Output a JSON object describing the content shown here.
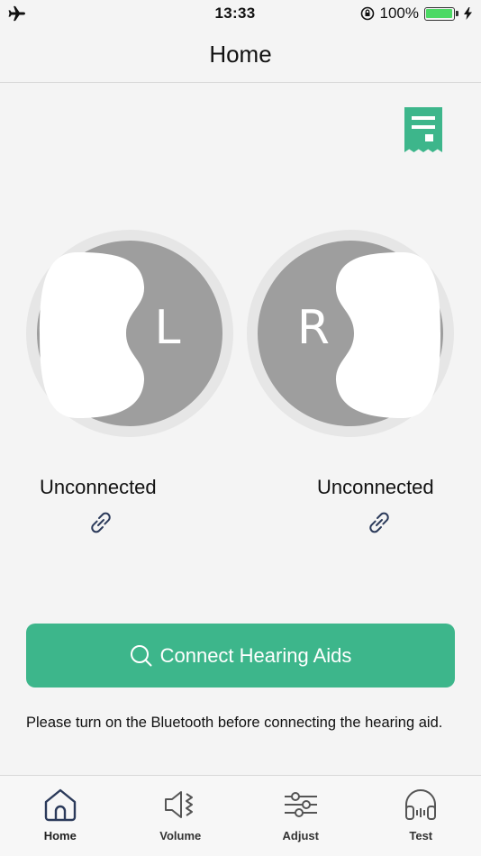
{
  "status_bar": {
    "time": "13:33",
    "battery_text": "100%",
    "battery_level": 1.0,
    "icons": [
      "airplane-icon",
      "rotation-lock-icon",
      "battery-icon",
      "charging-bolt-icon"
    ]
  },
  "nav": {
    "title": "Home"
  },
  "ears": {
    "left": {
      "letter": "L",
      "status": "Unconnected"
    },
    "right": {
      "letter": "R",
      "status": "Unconnected"
    }
  },
  "connect_button": {
    "label": "Connect Hearing Aids",
    "icon": "search-icon"
  },
  "hint": "Please turn on the Bluetooth before connecting the hearing aid.",
  "tabs": [
    {
      "label": "Home",
      "icon": "home-icon",
      "active": true
    },
    {
      "label": "Volume",
      "icon": "speaker-icon",
      "active": false
    },
    {
      "label": "Adjust",
      "icon": "sliders-icon",
      "active": false
    },
    {
      "label": "Test",
      "icon": "headphones-icon",
      "active": false
    }
  ],
  "colors": {
    "accent": "#3db68b",
    "ear_gray": "#9e9e9e",
    "ring": "#e6e6e6",
    "link_icon": "#2b3a5a"
  }
}
